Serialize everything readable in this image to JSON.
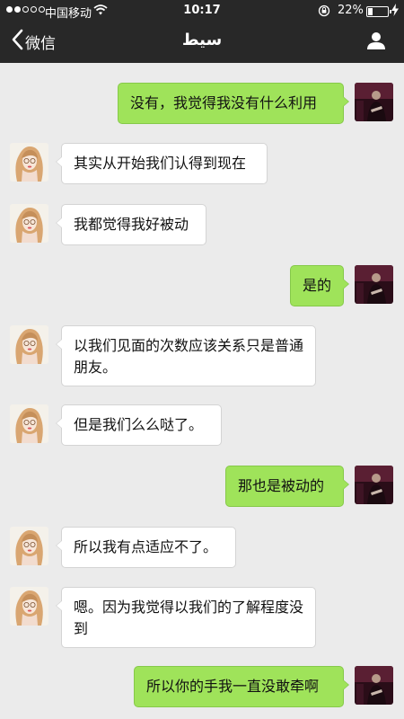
{
  "status_bar": {
    "carrier": "中国移动",
    "time": "10:17",
    "battery_percent": "22%",
    "battery_level": 0.22,
    "signal_bars_filled": 2,
    "signal_bars_total": 5
  },
  "nav": {
    "back_label": "微信",
    "title": "سيط"
  },
  "colors": {
    "header_bg": "#282828",
    "chat_bg": "#ebebeb",
    "outgoing_bubble": "#9fe35a",
    "incoming_bubble": "#ffffff"
  },
  "messages": [
    {
      "side": "right",
      "text": "没有，我觉得我没有什么利用"
    },
    {
      "side": "left",
      "text": "其实从开始我们认得到现在"
    },
    {
      "side": "left",
      "text": "我都觉得我好被动"
    },
    {
      "side": "right",
      "text": "是的"
    },
    {
      "side": "left",
      "text": "以我们见面的次数应该关系只是普通朋友。"
    },
    {
      "side": "left",
      "text": "但是我们么么哒了。"
    },
    {
      "side": "right",
      "text": "那也是被动的"
    },
    {
      "side": "left",
      "text": "所以我有点适应不了。"
    },
    {
      "side": "left",
      "text": "嗯。因为我觉得以我们的了解程度没到"
    },
    {
      "side": "right",
      "text": "所以你的手我一直没敢牵啊"
    }
  ]
}
